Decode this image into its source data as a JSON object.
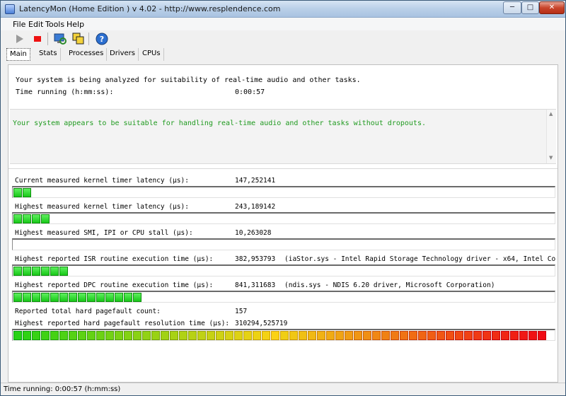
{
  "window": {
    "title": "LatencyMon  (Home Edition )  v 4.02 - http://www.resplendence.com",
    "min_glyph": "─",
    "max_glyph": "□",
    "close_glyph": "✕"
  },
  "menu": {
    "items": [
      "File",
      "Edit",
      "Tools",
      "Help"
    ]
  },
  "toolbar": {
    "icons": [
      "play-icon",
      "stop-icon",
      "scan-computer-icon",
      "copy-windows-icon",
      "help-icon"
    ]
  },
  "tabs": [
    {
      "label": "Main",
      "active": true
    },
    {
      "label": "Stats",
      "active": false
    },
    {
      "label": "Processes",
      "active": false
    },
    {
      "label": "Drivers",
      "active": false
    },
    {
      "label": "CPUs",
      "active": false
    }
  ],
  "main": {
    "analyzing_text": "Your system is being analyzed for suitability of real-time audio and other tasks.",
    "time_running_label": "Time running (h:mm:ss):",
    "time_running_value": "0:00:57",
    "verdict": "Your system appears to be suitable for handling real-time audio and other tasks without dropouts.",
    "verdict_color": "#1f9a1f",
    "stats": [
      {
        "label": "Current measured kernel timer latency (µs):",
        "value": "147,252141",
        "extra": "",
        "bar_fraction": 0.034
      },
      {
        "label": "Highest measured kernel timer latency (µs):",
        "value": "243,189142",
        "extra": "",
        "bar_fraction": 0.068
      },
      {
        "label": "Highest measured SMI, IPI or CPU stall (µs):",
        "value": "10,263028",
        "extra": "",
        "bar_fraction": 0
      },
      {
        "label": "Highest reported ISR routine execution time (µs):",
        "value": "382,953793",
        "extra": "(iaStor.sys - Intel Rapid Storage Technology driver - x64, Intel Co",
        "bar_fraction": 0.102
      },
      {
        "label": "Highest reported DPC routine execution time (µs):",
        "value": "841,311683",
        "extra": "(ndis.sys - NDIS 6.20 driver, Microsoft Corporation)",
        "bar_fraction": 0.238
      }
    ],
    "pagefault_count_label": "Reported total hard pagefault count:",
    "pagefault_count_value": "157",
    "pagefault_time_label": "Highest reported hard pagefault resolution time (µs):",
    "pagefault_time_value": "310294,525719",
    "pagefault_bar_fraction": 1.0
  },
  "status": {
    "text": "Time running: 0:00:57  (h:mm:ss)"
  }
}
